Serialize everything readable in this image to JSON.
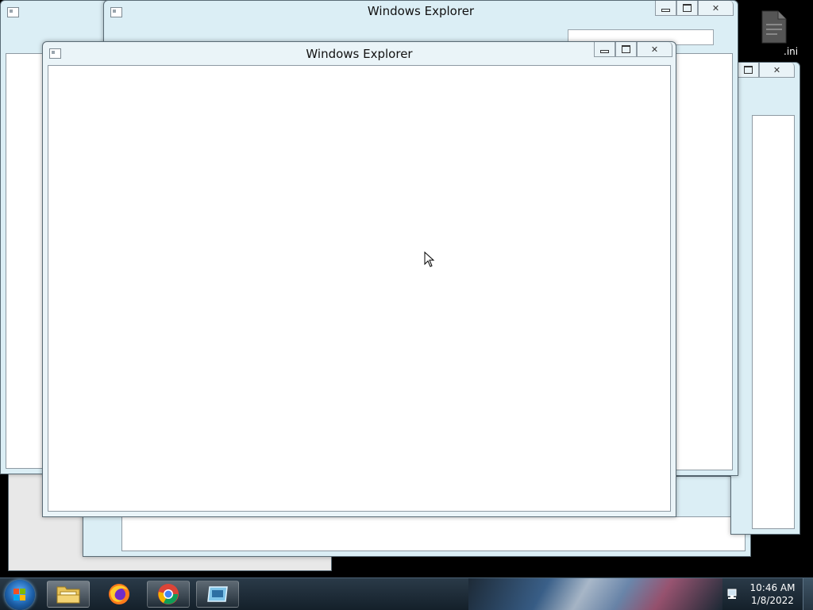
{
  "desktop": {
    "file_label": ".ini"
  },
  "windows": {
    "back": {
      "title": "Windows Explorer",
      "ghost_title": "Windows Explorer"
    },
    "front": {
      "title": "Windows Explorer"
    }
  },
  "taskbar": {
    "items": [
      {
        "name": "windows-explorer",
        "icon": "folder-icon"
      },
      {
        "name": "firefox",
        "icon": "firefox-icon"
      },
      {
        "name": "chrome",
        "icon": "chrome-icon"
      },
      {
        "name": "app",
        "icon": "window-app-icon"
      }
    ],
    "clock": {
      "time": "10:46 AM",
      "date": "1/8/2022"
    }
  },
  "colors": {
    "taskbar": "#1a2733",
    "window_frame": "#dbeef5",
    "accent": "#3f6a9a"
  }
}
